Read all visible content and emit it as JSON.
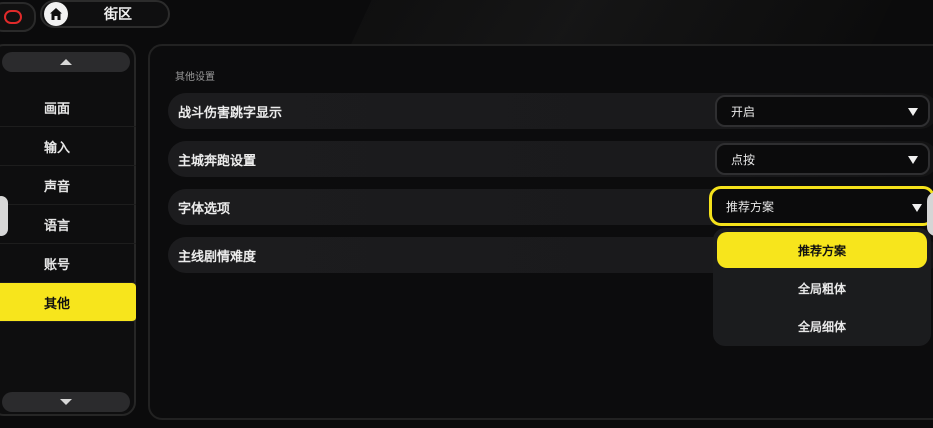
{
  "header": {
    "location_label": "街区",
    "home_icon": "home-icon",
    "back_icon": "back-icon"
  },
  "sidebar": {
    "items": [
      {
        "label": "画面"
      },
      {
        "label": "输入"
      },
      {
        "label": "声音"
      },
      {
        "label": "语言"
      },
      {
        "label": "账号"
      },
      {
        "label": "其他",
        "active": true
      }
    ]
  },
  "main": {
    "section_title": "其他设置",
    "rows": [
      {
        "label": "战斗伤害跳字显示",
        "value": "开启"
      },
      {
        "label": "主城奔跑设置",
        "value": "点按"
      },
      {
        "label": "字体选项",
        "value": "推荐方案"
      },
      {
        "label": "主线剧情难度"
      }
    ],
    "dropdown": {
      "options": [
        "推荐方案",
        "全局粗体",
        "全局细体"
      ],
      "selected": "推荐方案"
    }
  },
  "colors": {
    "accent": "#f7e51c",
    "background": "#0b0b0c",
    "row": "#1c1c1e",
    "back_ring": "#e02a2a"
  }
}
